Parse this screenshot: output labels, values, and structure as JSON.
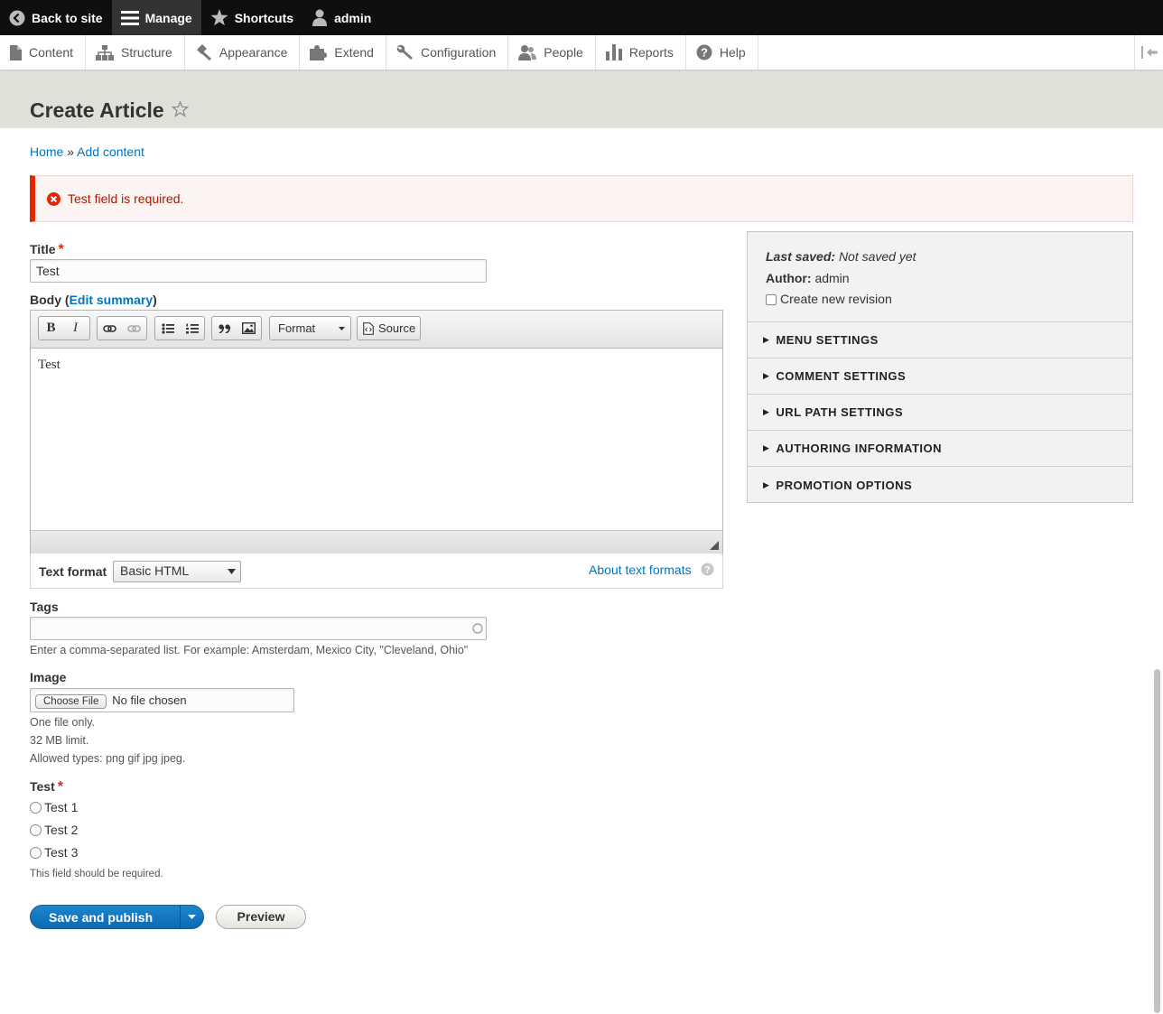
{
  "toolbar": {
    "back_to_site": "Back to site",
    "manage": "Manage",
    "shortcuts": "Shortcuts",
    "user": "admin"
  },
  "tray": {
    "content": "Content",
    "structure": "Structure",
    "appearance": "Appearance",
    "extend": "Extend",
    "configuration": "Configuration",
    "people": "People",
    "reports": "Reports",
    "help": "Help"
  },
  "page": {
    "title": "Create Article"
  },
  "breadcrumb": {
    "home": "Home",
    "separator": "»",
    "add_content": "Add content"
  },
  "message": {
    "error_text": "Test field is required.",
    "error_color": "#e62600"
  },
  "form": {
    "title_label": "Title",
    "required_mark": "*",
    "title_value": "Test",
    "body_label": "Body",
    "body_paren_open": "(",
    "edit_summary": "Edit summary",
    "body_paren_close": ")",
    "editor": {
      "format_dropdown": "Format",
      "source_button": "Source",
      "content": "Test"
    },
    "text_format_label": "Text format",
    "text_format_value": "Basic HTML",
    "about_text_formats": "About text formats",
    "tags_label": "Tags",
    "tags_value": "",
    "tags_desc": "Enter a comma-separated list. For example: Amsterdam, Mexico City, \"Cleveland, Ohio\"",
    "image_label": "Image",
    "choose_file": "Choose File",
    "no_file": "No file chosen",
    "image_desc_1": "One file only.",
    "image_desc_2": "32 MB limit.",
    "image_desc_3": "Allowed types: png gif jpg jpeg.",
    "test_label": "Test",
    "test_options": [
      "Test 1",
      "Test 2",
      "Test 3"
    ],
    "test_desc": "This field should be required."
  },
  "actions": {
    "save_publish": "Save and publish",
    "preview": "Preview"
  },
  "sidebar": {
    "last_saved_label": "Last saved:",
    "last_saved_value": "Not saved yet",
    "author_label": "Author:",
    "author_value": "admin",
    "create_revision": "Create new revision",
    "sections": [
      "MENU SETTINGS",
      "COMMENT SETTINGS",
      "URL PATH SETTINGS",
      "AUTHORING INFORMATION",
      "PROMOTION OPTIONS"
    ]
  },
  "colors": {
    "link": "#0074bd",
    "primary_button": "#0a6ab6",
    "header_bg": "#e0e0d8"
  }
}
